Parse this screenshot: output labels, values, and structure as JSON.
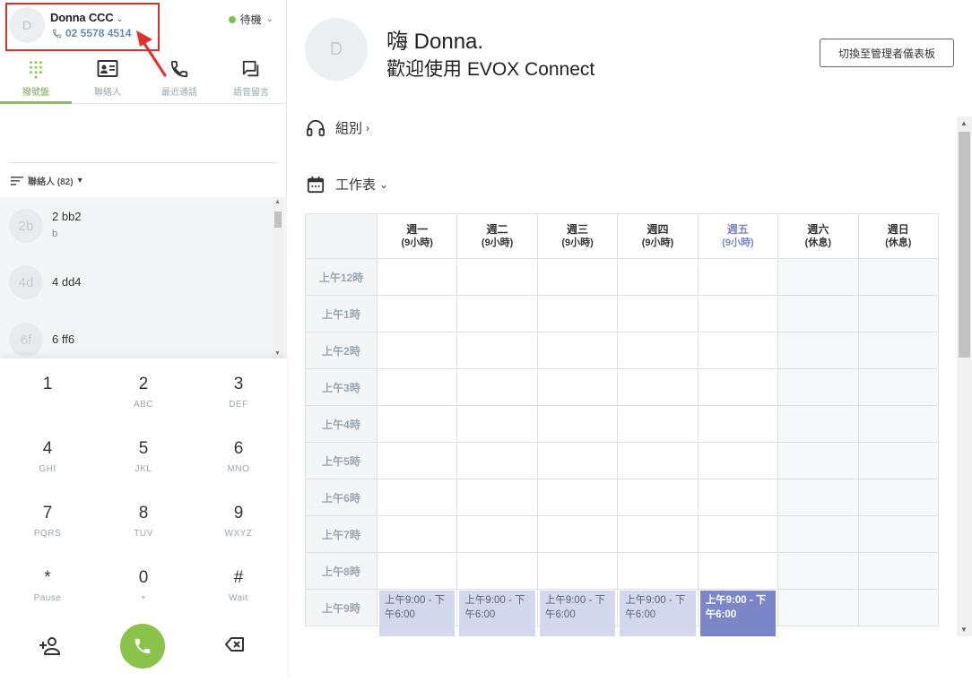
{
  "user": {
    "avatar_initial": "D",
    "name": "Donna CCC",
    "phone": "02 5578 4514"
  },
  "status": {
    "label": "待機",
    "color": "#7cc14f"
  },
  "nav_tabs": [
    {
      "label": "撥號盤",
      "icon": "dialpad-icon",
      "active": true
    },
    {
      "label": "聯絡人",
      "icon": "contact-card-icon",
      "active": false
    },
    {
      "label": "最近通話",
      "icon": "phone-icon",
      "active": false
    },
    {
      "label": "語音留言",
      "icon": "voicemail-icon",
      "active": false
    }
  ],
  "contacts": {
    "header": "聯絡人 (82)",
    "items": [
      {
        "initials": "2b",
        "name": "2 bb2",
        "sub": "b"
      },
      {
        "initials": "4d",
        "name": "4 dd4",
        "sub": ""
      },
      {
        "initials": "6f",
        "name": "6 ff6",
        "sub": ""
      }
    ]
  },
  "dialpad": {
    "keys": [
      {
        "digit": "1",
        "letters": ""
      },
      {
        "digit": "2",
        "letters": "ABC"
      },
      {
        "digit": "3",
        "letters": "DEF"
      },
      {
        "digit": "4",
        "letters": "GHI"
      },
      {
        "digit": "5",
        "letters": "JKL"
      },
      {
        "digit": "6",
        "letters": "MNO"
      },
      {
        "digit": "7",
        "letters": "PQRS"
      },
      {
        "digit": "8",
        "letters": "TUV"
      },
      {
        "digit": "9",
        "letters": "WXYZ"
      },
      {
        "digit": "*",
        "letters": "Pause"
      },
      {
        "digit": "0",
        "letters": "+"
      },
      {
        "digit": "#",
        "letters": "Wait"
      }
    ],
    "call_color": "#8bc34a"
  },
  "main": {
    "avatar_initial": "D",
    "greeting": "嗨 Donna.",
    "welcome": "歡迎使用 EVOX Connect",
    "switch_button": "切換至管理者儀表板",
    "groups_label": "組別",
    "schedule_label": "工作表"
  },
  "schedule": {
    "days": [
      {
        "name": "週一",
        "hours": "(9小時)",
        "today": false,
        "off": false
      },
      {
        "name": "週二",
        "hours": "(9小時)",
        "today": false,
        "off": false
      },
      {
        "name": "週三",
        "hours": "(9小時)",
        "today": false,
        "off": false
      },
      {
        "name": "週四",
        "hours": "(9小時)",
        "today": false,
        "off": false
      },
      {
        "name": "週五",
        "hours": "(9小時)",
        "today": true,
        "off": false
      },
      {
        "name": "週六",
        "hours": "(休息)",
        "today": false,
        "off": true
      },
      {
        "name": "週日",
        "hours": "(休息)",
        "today": false,
        "off": true
      }
    ],
    "hours": [
      "上午12時",
      "上午1時",
      "上午2時",
      "上午3時",
      "上午4時",
      "上午5時",
      "上午6時",
      "上午7時",
      "上午8時",
      "上午9時"
    ],
    "shift_text": "上午9:00 - 下午6:00",
    "accent": "#7b86c9",
    "shift_bg": "#d3d8ee"
  }
}
